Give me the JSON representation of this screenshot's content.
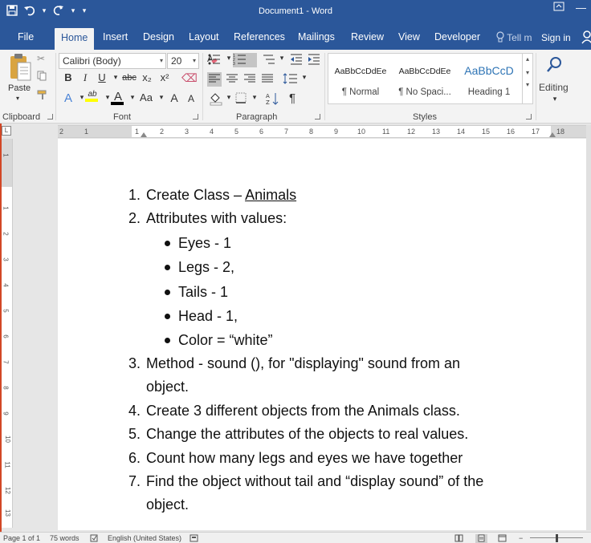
{
  "window": {
    "title": "Document1 - Word"
  },
  "tabs": [
    {
      "label": "File"
    },
    {
      "label": "Home"
    },
    {
      "label": "Insert"
    },
    {
      "label": "Design"
    },
    {
      "label": "Layout"
    },
    {
      "label": "References"
    },
    {
      "label": "Mailings"
    },
    {
      "label": "Review"
    },
    {
      "label": "View"
    },
    {
      "label": "Developer"
    }
  ],
  "tell_me": {
    "placeholder": "Tell m"
  },
  "account": {
    "sign_in_label": "Sign in"
  },
  "ribbon": {
    "clipboard": {
      "paste_label": "Paste",
      "group_label": "Clipboard"
    },
    "font": {
      "font_name": "Calibri (Body)",
      "font_size": "20",
      "group_label": "Font",
      "bold": "B",
      "italic": "I",
      "underline": "U",
      "strike": "abc",
      "subscript": "x₂",
      "superscript": "x²",
      "text_effects": "A",
      "change_case": "Aa",
      "grow": "A",
      "shrink": "A",
      "highlight": "ab",
      "font_color": "A"
    },
    "paragraph": {
      "group_label": "Paragraph"
    },
    "styles": {
      "group_label": "Styles",
      "items": [
        {
          "sample": "AaBbCcDdEe",
          "name": "¶ Normal"
        },
        {
          "sample": "AaBbCcDdEe",
          "name": "¶ No Spaci..."
        },
        {
          "sample": "AaBbCcD",
          "name": "Heading 1"
        }
      ]
    },
    "editing": {
      "label": "Editing"
    }
  },
  "ruler": {
    "h_numbers": [
      "2",
      "1",
      "1",
      "2",
      "3",
      "4",
      "5",
      "6",
      "7",
      "8",
      "9",
      "10",
      "11",
      "12",
      "13",
      "14",
      "15",
      "16",
      "17",
      "18"
    ],
    "v_numbers": [
      "1",
      "1",
      "2",
      "3",
      "4",
      "5",
      "6",
      "7",
      "8",
      "9",
      "10",
      "11",
      "12",
      "13"
    ]
  },
  "document": {
    "items": [
      {
        "num": "1.",
        "text_before": "Create Class – ",
        "text_underlined": "Animals"
      },
      {
        "num": "2.",
        "text": "Attributes with values:"
      },
      {
        "bullet": true,
        "text": "Eyes - 1"
      },
      {
        "bullet": true,
        "text": "Legs - 2,"
      },
      {
        "bullet": true,
        "text": "Tails - 1"
      },
      {
        "bullet": true,
        "text": "Head - 1,"
      },
      {
        "bullet": true,
        "text": "Color = “white”"
      },
      {
        "num": "3.",
        "text": "Method - sound (), for \"displaying\" sound from an"
      },
      {
        "cont": true,
        "text": "object."
      },
      {
        "num": "4.",
        "text": "Create 3 different objects from the Animals class."
      },
      {
        "num": "5.",
        "text": "Change the attributes of the objects to real values."
      },
      {
        "num": "6.",
        "text": "Count how many legs and eyes we have together"
      },
      {
        "num": "7.",
        "text": "Find the object without tail and “display sound” of the"
      },
      {
        "cont": true,
        "text": "object."
      }
    ]
  },
  "status": {
    "page": "Page 1 of 1",
    "words": "75 words",
    "language": "English (United States)"
  },
  "colors": {
    "accent": "#2b579a",
    "ribbon_bg": "#f3f3f3",
    "heading_style": "#2e74b5"
  }
}
